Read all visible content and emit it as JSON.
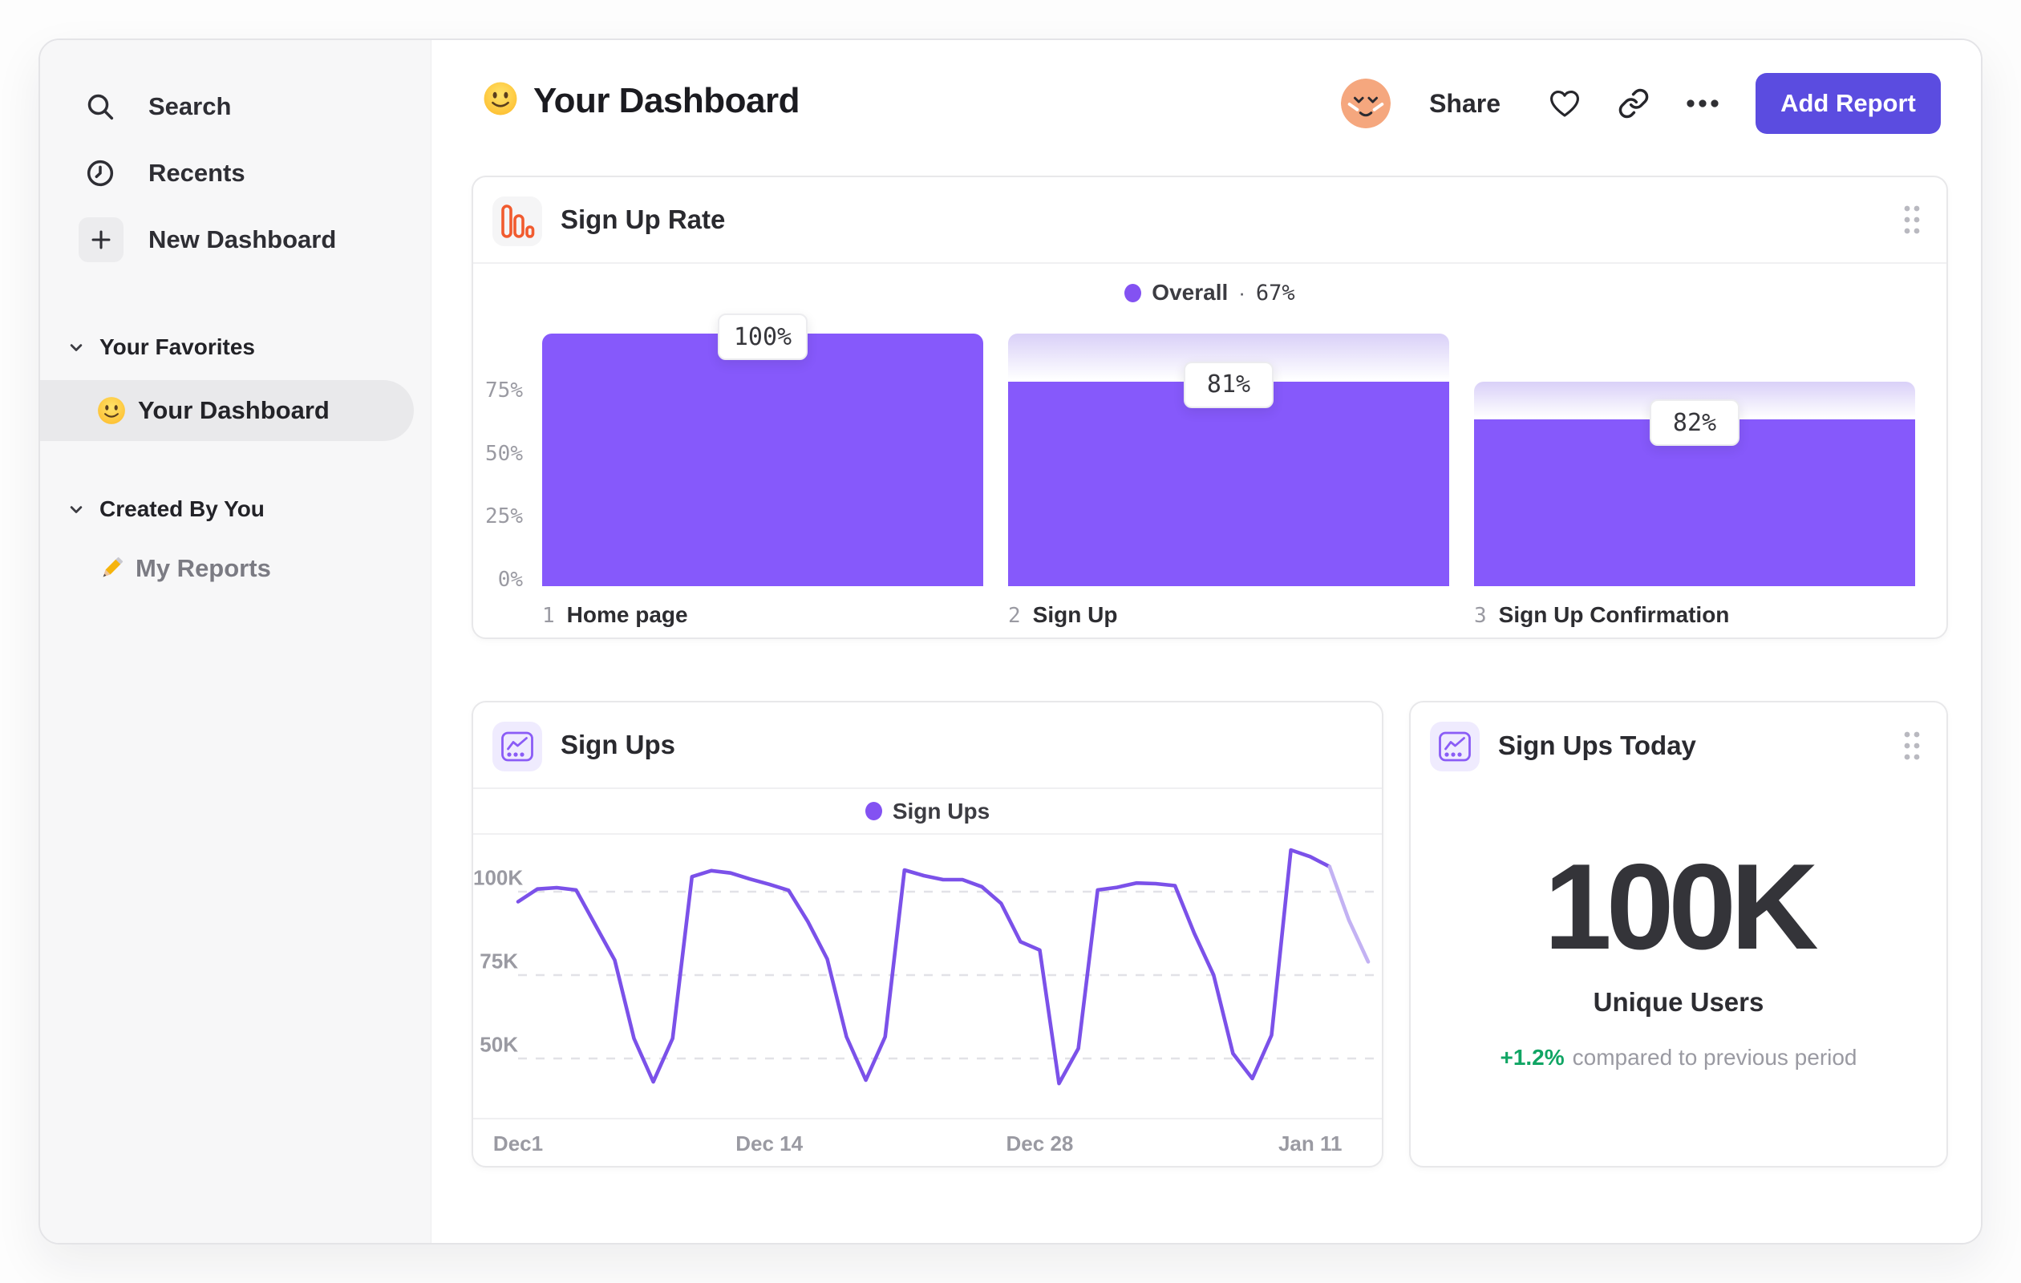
{
  "sidebar": {
    "nav": [
      {
        "label": "Search"
      },
      {
        "label": "Recents"
      },
      {
        "label": "New Dashboard"
      }
    ],
    "sections": [
      {
        "label": "Your Favorites",
        "items": [
          {
            "label": "Your Dashboard",
            "selected": true
          }
        ]
      },
      {
        "label": "Created By You",
        "items": [
          {
            "label": "My Reports",
            "selected": false
          }
        ]
      }
    ]
  },
  "header": {
    "title": "Your Dashboard",
    "share_label": "Share",
    "add_report_label": "Add Report"
  },
  "cards": {
    "funnel": {
      "title": "Sign Up Rate"
    },
    "line": {
      "title": "Sign Ups"
    },
    "today": {
      "title": "Sign Ups Today",
      "value": "100K",
      "label": "Unique Users",
      "delta": "+1.2%",
      "compare_text": "compared to previous period"
    }
  },
  "theme": {
    "bar_purple": "#8659fb",
    "line_purple": "#7b51e9",
    "line_faded": "#c3b2f3",
    "button_purple": "#5b4ce0",
    "icon_orange": "#f15b2f",
    "delta_green": "#10a564",
    "grid_gray": "#e2e2e7"
  },
  "chart_data": [
    {
      "id": "sign-up-rate",
      "type": "bar",
      "title": "Sign Up Rate",
      "legend": {
        "label": "Overall",
        "separator": "·",
        "value": "67%"
      },
      "ymax": 100,
      "yticks": [
        {
          "label": "75%",
          "value": 75
        },
        {
          "label": "50%",
          "value": 50
        },
        {
          "label": "25%",
          "value": 25
        },
        {
          "label": "0%",
          "value": 0
        }
      ],
      "steps": [
        {
          "index": "1",
          "label": "Home page",
          "percent": 100,
          "from_percent": 100,
          "data_label": "100%"
        },
        {
          "index": "2",
          "label": "Sign Up",
          "percent": 81,
          "from_percent": 100,
          "data_label": "81%"
        },
        {
          "index": "3",
          "label": "Sign Up Confirmation",
          "percent": 66,
          "from_percent": 81,
          "data_label": "82%"
        }
      ]
    },
    {
      "id": "sign-ups",
      "type": "line",
      "title": "Sign Ups",
      "legend": {
        "label": "Sign Ups"
      },
      "unit": "K",
      "ylim": [
        40,
        115
      ],
      "grid": "dashed-horizontal",
      "yticks": [
        {
          "label": "100K",
          "value": 100
        },
        {
          "label": "75K",
          "value": 75
        },
        {
          "label": "50K",
          "value": 50
        }
      ],
      "x_axis_labels": [
        {
          "label": "Dec1",
          "day": 0
        },
        {
          "label": "Dec 14",
          "day": 13
        },
        {
          "label": "Dec 28",
          "day": 27
        },
        {
          "label": "Jan 11",
          "day": 41
        }
      ],
      "values": [
        97,
        100.8,
        101.2,
        100.5,
        90,
        79.5,
        56,
        43,
        56,
        104.5,
        106.3,
        105.6,
        103.8,
        102.2,
        100.4,
        91,
        79.8,
        56.5,
        43.5,
        56.5,
        106.5,
        104.8,
        103.6,
        103.6,
        101.5,
        96.5,
        85,
        82.5,
        42.5,
        53,
        100.5,
        101.3,
        102.6,
        102.4,
        101.8,
        87.5,
        75,
        51.5,
        44,
        57,
        112.5,
        110.5,
        107.5,
        91.5,
        79
      ],
      "faded_from_index": 42
    }
  ]
}
